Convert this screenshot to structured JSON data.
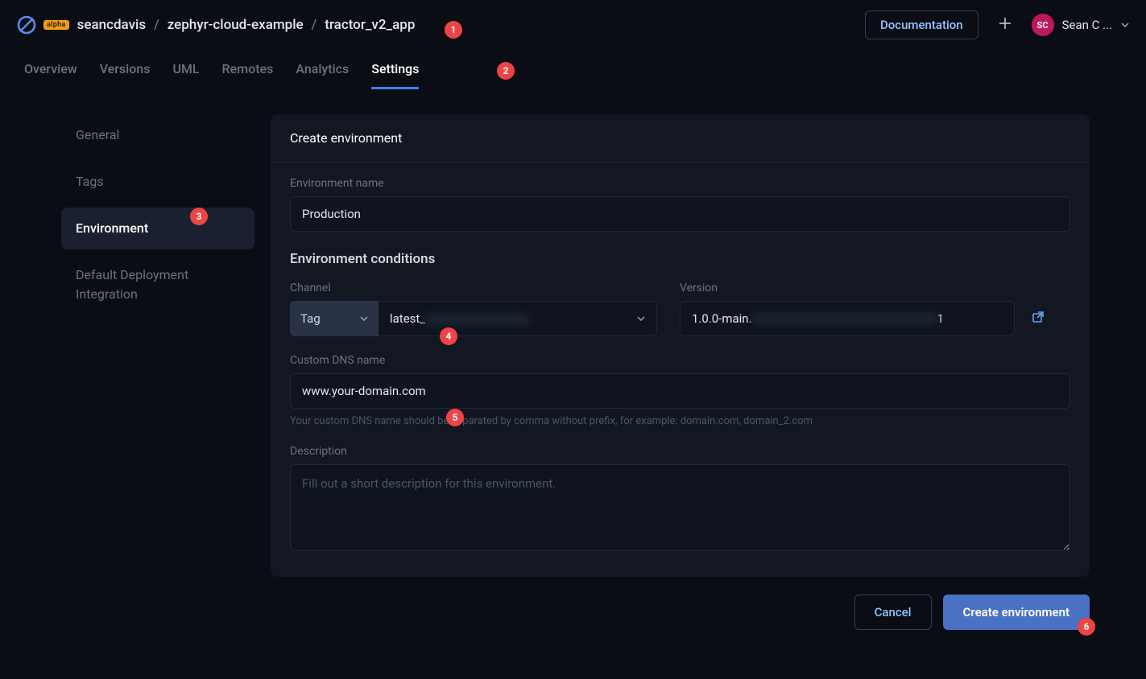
{
  "alpha_badge": "alpha",
  "breadcrumbs": {
    "org": "seancdavis",
    "project": "zephyr-cloud-example",
    "app": "tractor_v2_app"
  },
  "topbar": {
    "documentation_label": "Documentation",
    "user_initials": "SC",
    "user_name": "Sean C ..."
  },
  "tabs": {
    "overview": "Overview",
    "versions": "Versions",
    "uml": "UML",
    "remotes": "Remotes",
    "analytics": "Analytics",
    "settings": "Settings"
  },
  "sidebar": {
    "general": "General",
    "tags": "Tags",
    "environment": "Environment",
    "default_deployment": "Default Deployment Integration"
  },
  "panel": {
    "title": "Create environment",
    "env_name_label": "Environment name",
    "env_name_value": "Production",
    "conditions_heading": "Environment conditions",
    "channel_label": "Channel",
    "channel_type": "Tag",
    "channel_value_prefix": "latest_",
    "version_label": "Version",
    "version_value_prefix": "1.0.0-main.",
    "version_value_suffix": "1",
    "dns_label": "Custom DNS name",
    "dns_value": "www.your-domain.com",
    "dns_helper": "Your custom DNS name should be separated by comma without prefix, for example: domain.com, domain_2.com",
    "description_label": "Description",
    "description_placeholder": "Fill out a short description for this environment."
  },
  "actions": {
    "cancel": "Cancel",
    "create": "Create environment"
  },
  "callouts": {
    "c1": "1",
    "c2": "2",
    "c3": "3",
    "c4": "4",
    "c5": "5",
    "c6": "6"
  }
}
